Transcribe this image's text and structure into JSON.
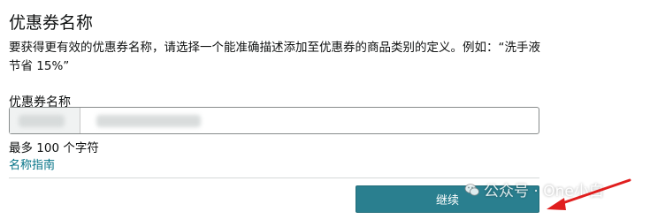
{
  "page": {
    "title": "优惠券名称",
    "description": "要获得更有效的优惠券名称，请选择一个能准确描述添加至优惠券的商品类别的定义。例如：“洗手液节省 15%”"
  },
  "form": {
    "field_label": "优惠券名称",
    "char_limit": "最多 100 个字符",
    "guide_link": "名称指南"
  },
  "actions": {
    "continue_label": "继续"
  },
  "watermark": {
    "text": "公众号 · One小白"
  },
  "colors": {
    "button": "#2a7f8f",
    "link": "#007185",
    "arrow": "#e01e1e"
  }
}
